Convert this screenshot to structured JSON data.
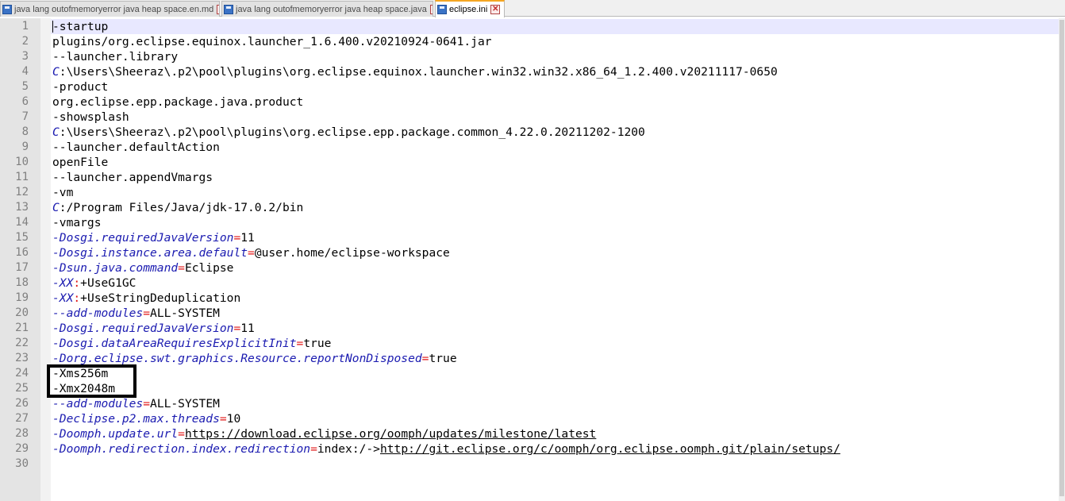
{
  "tabs": [
    {
      "label": "java lang outofmemoryerror java heap space.en.md",
      "active": false
    },
    {
      "label": "java lang outofmemoryerror java heap space.java",
      "active": false
    },
    {
      "label": "eclipse.ini",
      "active": true
    }
  ],
  "close_glyph": "✕",
  "colors": {
    "keyword": "#1a1ab0",
    "operator": "#e01010",
    "current_line": "#e8e8ff",
    "gutter": "#e4e4e4",
    "highlight_box": "#000000"
  },
  "editor": {
    "lines": [
      {
        "n": "1",
        "parts": [
          {
            "t": "-startup"
          }
        ]
      },
      {
        "n": "2",
        "parts": [
          {
            "t": "plugins/org.eclipse.equinox.launcher_1.6.400.v20210924-0641.jar"
          }
        ]
      },
      {
        "n": "3",
        "parts": [
          {
            "t": "--launcher.library"
          }
        ]
      },
      {
        "n": "4",
        "parts": [
          {
            "t": "C",
            "c": "drive"
          },
          {
            "t": ":\\Users\\Sheeraz\\.p2\\pool\\plugins\\org.eclipse.equinox.launcher.win32.win32.x86_64_1.2.400.v20211117-0650"
          }
        ]
      },
      {
        "n": "5",
        "parts": [
          {
            "t": "-product"
          }
        ]
      },
      {
        "n": "6",
        "parts": [
          {
            "t": "org.eclipse.epp.package.java.product"
          }
        ]
      },
      {
        "n": "7",
        "parts": [
          {
            "t": "-showsplash"
          }
        ]
      },
      {
        "n": "8",
        "parts": [
          {
            "t": "C",
            "c": "drive"
          },
          {
            "t": ":\\Users\\Sheeraz\\.p2\\pool\\plugins\\org.eclipse.epp.package.common_4.22.0.20211202-1200"
          }
        ]
      },
      {
        "n": "9",
        "parts": [
          {
            "t": "--launcher.defaultAction"
          }
        ]
      },
      {
        "n": "10",
        "parts": [
          {
            "t": "openFile"
          }
        ]
      },
      {
        "n": "11",
        "parts": [
          {
            "t": "--launcher.appendVmargs"
          }
        ]
      },
      {
        "n": "12",
        "parts": [
          {
            "t": "-vm"
          }
        ]
      },
      {
        "n": "13",
        "parts": [
          {
            "t": "C",
            "c": "drive"
          },
          {
            "t": ":/Program Files/Java/jdk-17.0.2/bin"
          }
        ]
      },
      {
        "n": "14",
        "parts": [
          {
            "t": "-vmargs"
          }
        ]
      },
      {
        "n": "15",
        "parts": [
          {
            "t": "-Dosgi.requiredJavaVersion",
            "c": "key"
          },
          {
            "t": "=",
            "c": "op"
          },
          {
            "t": "11"
          }
        ]
      },
      {
        "n": "16",
        "parts": [
          {
            "t": "-Dosgi.instance.area.default",
            "c": "key"
          },
          {
            "t": "=",
            "c": "op"
          },
          {
            "t": "@user.home/eclipse-workspace"
          }
        ]
      },
      {
        "n": "17",
        "parts": [
          {
            "t": "-Dsun.java.command",
            "c": "key"
          },
          {
            "t": "=",
            "c": "op"
          },
          {
            "t": "Eclipse"
          }
        ]
      },
      {
        "n": "18",
        "parts": [
          {
            "t": "-XX",
            "c": "key"
          },
          {
            "t": ":",
            "c": "op"
          },
          {
            "t": "+UseG1GC"
          }
        ]
      },
      {
        "n": "19",
        "parts": [
          {
            "t": "-XX",
            "c": "key"
          },
          {
            "t": ":",
            "c": "op"
          },
          {
            "t": "+UseStringDeduplication"
          }
        ]
      },
      {
        "n": "20",
        "parts": [
          {
            "t": "--add-modules",
            "c": "key"
          },
          {
            "t": "=",
            "c": "op"
          },
          {
            "t": "ALL-SYSTEM"
          }
        ]
      },
      {
        "n": "21",
        "parts": [
          {
            "t": "-Dosgi.requiredJavaVersion",
            "c": "key"
          },
          {
            "t": "=",
            "c": "op"
          },
          {
            "t": "11"
          }
        ]
      },
      {
        "n": "22",
        "parts": [
          {
            "t": "-Dosgi.dataAreaRequiresExplicitInit",
            "c": "key"
          },
          {
            "t": "=",
            "c": "op"
          },
          {
            "t": "true"
          }
        ]
      },
      {
        "n": "23",
        "parts": [
          {
            "t": "-Dorg.eclipse.swt.graphics.Resource.reportNonDisposed",
            "c": "key"
          },
          {
            "t": "=",
            "c": "op"
          },
          {
            "t": "true"
          }
        ]
      },
      {
        "n": "24",
        "parts": [
          {
            "t": "-Xms256m"
          }
        ]
      },
      {
        "n": "25",
        "parts": [
          {
            "t": "-Xmx2048m"
          }
        ]
      },
      {
        "n": "26",
        "parts": [
          {
            "t": "--add-modules",
            "c": "key"
          },
          {
            "t": "=",
            "c": "op"
          },
          {
            "t": "ALL-SYSTEM"
          }
        ]
      },
      {
        "n": "27",
        "parts": [
          {
            "t": "-Declipse.p2.max.threads",
            "c": "key"
          },
          {
            "t": "=",
            "c": "op"
          },
          {
            "t": "10"
          }
        ]
      },
      {
        "n": "28",
        "parts": [
          {
            "t": "-Doomph.update.url",
            "c": "key"
          },
          {
            "t": "=",
            "c": "op"
          },
          {
            "t": "https://download.eclipse.org/oomph/updates/milestone/latest",
            "c": "url"
          }
        ]
      },
      {
        "n": "29",
        "parts": [
          {
            "t": "-Doomph.redirection.index.redirection",
            "c": "key"
          },
          {
            "t": "=",
            "c": "op"
          },
          {
            "t": "index:/->"
          },
          {
            "t": "http://git.eclipse.org/c/oomph/org.eclipse.oomph.git/plain/setups/",
            "c": "url"
          }
        ]
      },
      {
        "n": "30",
        "parts": []
      }
    ]
  }
}
